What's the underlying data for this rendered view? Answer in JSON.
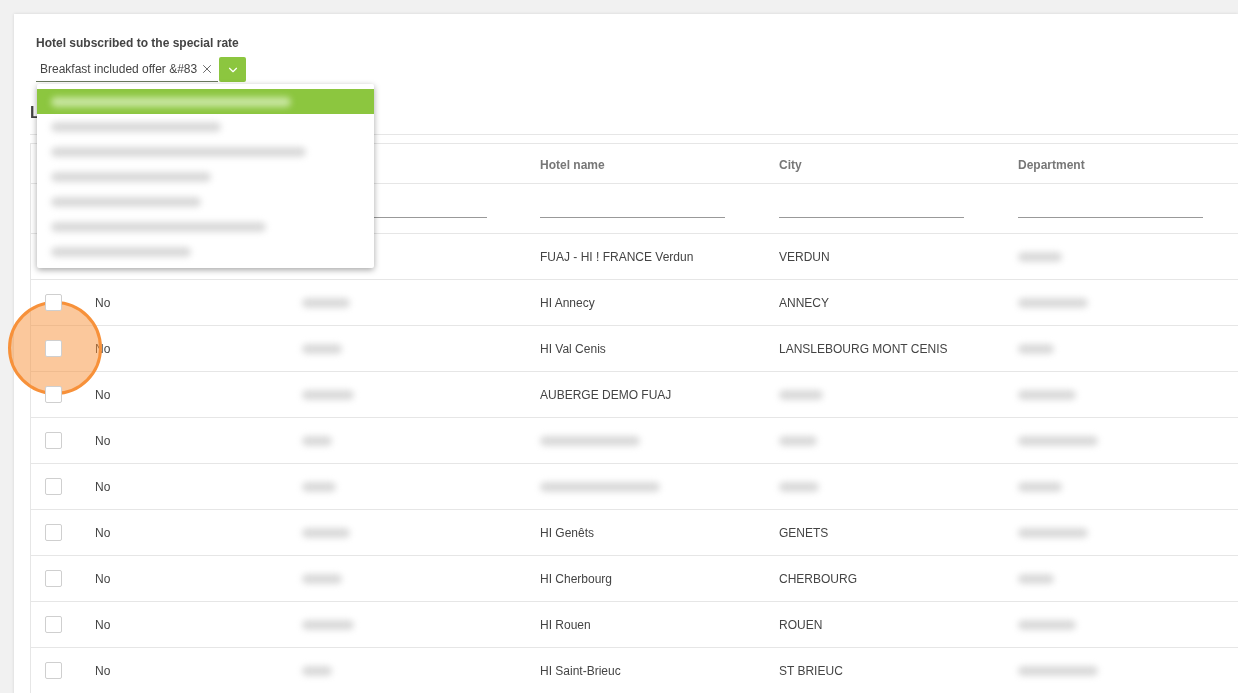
{
  "filter": {
    "label": "Hotel subscribed to the special rate",
    "value": "Breakfast included offer &#83",
    "dropdown": {
      "expanded": true,
      "options": [
        {
          "selected": true
        },
        {
          "selected": false
        },
        {
          "selected": false
        },
        {
          "selected": false
        },
        {
          "selected": false
        },
        {
          "selected": false
        },
        {
          "selected": false
        }
      ]
    }
  },
  "section": {
    "title": "L"
  },
  "table": {
    "columns": [
      {},
      {
        "filter": true
      },
      {
        "heading": "Hotel name",
        "filter": true
      },
      {
        "heading": "City",
        "filter": true
      },
      {
        "heading": "Department",
        "filter": true
      }
    ],
    "rows": [
      {
        "cells": [
          "",
          "",
          {
            "kind": "text",
            "text": "FUAJ - HI ! FRANCE Verdun"
          },
          {
            "kind": "text",
            "text": "VERDUN"
          },
          {
            "kind": "blurred"
          }
        ]
      },
      {
        "checked": false,
        "cells": [
          {
            "kind": "text",
            "text": "No"
          },
          {
            "kind": "blurred"
          },
          {
            "kind": "text",
            "text": "HI Annecy"
          },
          {
            "kind": "text",
            "text": "ANNECY"
          },
          {
            "kind": "blurred"
          }
        ]
      },
      {
        "checked": false,
        "cells": [
          {
            "kind": "text",
            "text": "No"
          },
          {
            "kind": "blurred"
          },
          {
            "kind": "text",
            "text": "HI Val Cenis"
          },
          {
            "kind": "text",
            "text": "LANSLEBOURG MONT CENIS"
          },
          {
            "kind": "blurred"
          }
        ]
      },
      {
        "checked": false,
        "cells": [
          {
            "kind": "text",
            "text": "No"
          },
          {
            "kind": "blurred"
          },
          {
            "kind": "text",
            "text": "AUBERGE DEMO FUAJ"
          },
          {
            "kind": "blurred"
          },
          {
            "kind": "blurred"
          }
        ]
      },
      {
        "checked": false,
        "cells": [
          {
            "kind": "text",
            "text": "No"
          },
          {
            "kind": "blurred"
          },
          {
            "kind": "blurred"
          },
          {
            "kind": "blurred"
          },
          {
            "kind": "blurred"
          }
        ]
      },
      {
        "checked": false,
        "cells": [
          {
            "kind": "text",
            "text": "No"
          },
          {
            "kind": "blurred"
          },
          {
            "kind": "blurred"
          },
          {
            "kind": "blurred"
          },
          {
            "kind": "blurred"
          }
        ]
      },
      {
        "checked": false,
        "cells": [
          {
            "kind": "text",
            "text": "No"
          },
          {
            "kind": "blurred"
          },
          {
            "kind": "text",
            "text": "HI Genêts"
          },
          {
            "kind": "text",
            "text": "GENETS"
          },
          {
            "kind": "blurred"
          }
        ]
      },
      {
        "checked": false,
        "cells": [
          {
            "kind": "text",
            "text": "No"
          },
          {
            "kind": "blurred"
          },
          {
            "kind": "text",
            "text": "HI Cherbourg"
          },
          {
            "kind": "text",
            "text": "CHERBOURG"
          },
          {
            "kind": "blurred"
          }
        ]
      },
      {
        "checked": false,
        "cells": [
          {
            "kind": "text",
            "text": "No"
          },
          {
            "kind": "blurred"
          },
          {
            "kind": "text",
            "text": "HI Rouen"
          },
          {
            "kind": "text",
            "text": "ROUEN"
          },
          {
            "kind": "blurred"
          }
        ]
      },
      {
        "checked": false,
        "cells": [
          {
            "kind": "text",
            "text": "No"
          },
          {
            "kind": "blurred"
          },
          {
            "kind": "text",
            "text": "HI Saint-Brieuc"
          },
          {
            "kind": "text",
            "text": "ST BRIEUC"
          },
          {
            "kind": "blurred"
          }
        ]
      }
    ]
  }
}
